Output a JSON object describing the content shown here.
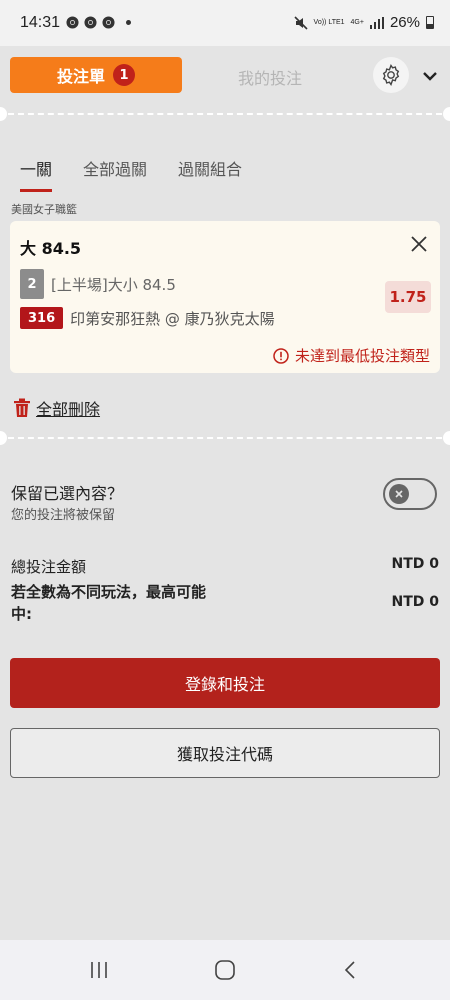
{
  "status_bar": {
    "time": "14:31",
    "network": [
      "Vo)) LTE1",
      "4G+"
    ],
    "battery": "26%"
  },
  "header": {
    "betslip_label": "投注單",
    "betslip_count": "1",
    "my_bets_label": "我的投注",
    "accent_color": "#f57c1a",
    "icons": [
      "settings-gear-icon",
      "chevron-down-icon"
    ]
  },
  "tabs": [
    {
      "label": "一關",
      "active": true
    },
    {
      "label": "全部過關",
      "active": false
    },
    {
      "label": "過關組合",
      "active": false
    }
  ],
  "league": "美國女子職籃",
  "bet": {
    "title": "大 84.5",
    "market_number": "2",
    "market": "[上半場]大小 84.5",
    "match_code": "316",
    "match": "印第安那狂熱 @ 康乃狄克太陽",
    "odds": "1.75",
    "warning": "未達到最低投注類型"
  },
  "delete_all_label": "全部刪除",
  "keep_selection": {
    "title": "保留已選內容？",
    "subtitle": "您的投注將被保留",
    "enabled": false
  },
  "summary": {
    "total_label": "總投注金額",
    "total_value": "NTD 0",
    "max_win_label": "若全數為不同玩法，最高可能中:",
    "max_win_value": "NTD 0"
  },
  "buttons": {
    "login_bet": "登錄和投注",
    "get_code": "獲取投注代碼"
  },
  "colors": {
    "brand_red": "#b3221c",
    "orange": "#f57c1a"
  }
}
